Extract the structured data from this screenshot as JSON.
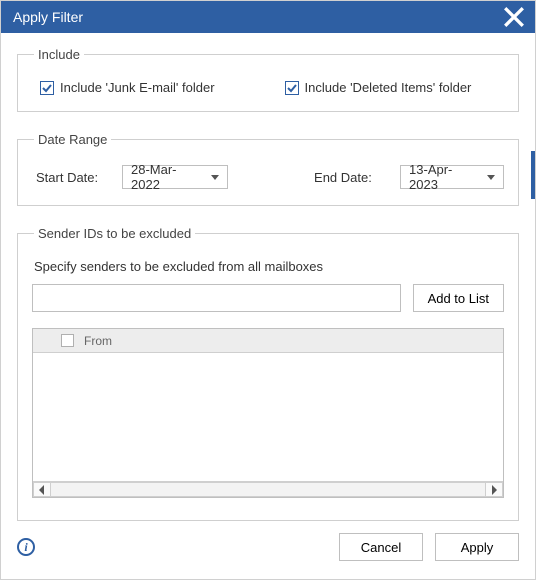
{
  "title": "Apply Filter",
  "include": {
    "legend": "Include",
    "junk": {
      "label": "Include 'Junk E-mail' folder",
      "checked": true
    },
    "deleted": {
      "label": "Include 'Deleted Items' folder",
      "checked": true
    }
  },
  "dateRange": {
    "legend": "Date Range",
    "startLabel": "Start Date:",
    "startValue": "28-Mar-2022",
    "endLabel": "End Date:",
    "endValue": "13-Apr-2023"
  },
  "senders": {
    "legend": "Sender IDs to be excluded",
    "instruction": "Specify senders to be excluded from all mailboxes",
    "inputValue": "",
    "addButton": "Add to List",
    "columnHeader": "From",
    "rows": []
  },
  "footer": {
    "cancel": "Cancel",
    "apply": "Apply"
  }
}
